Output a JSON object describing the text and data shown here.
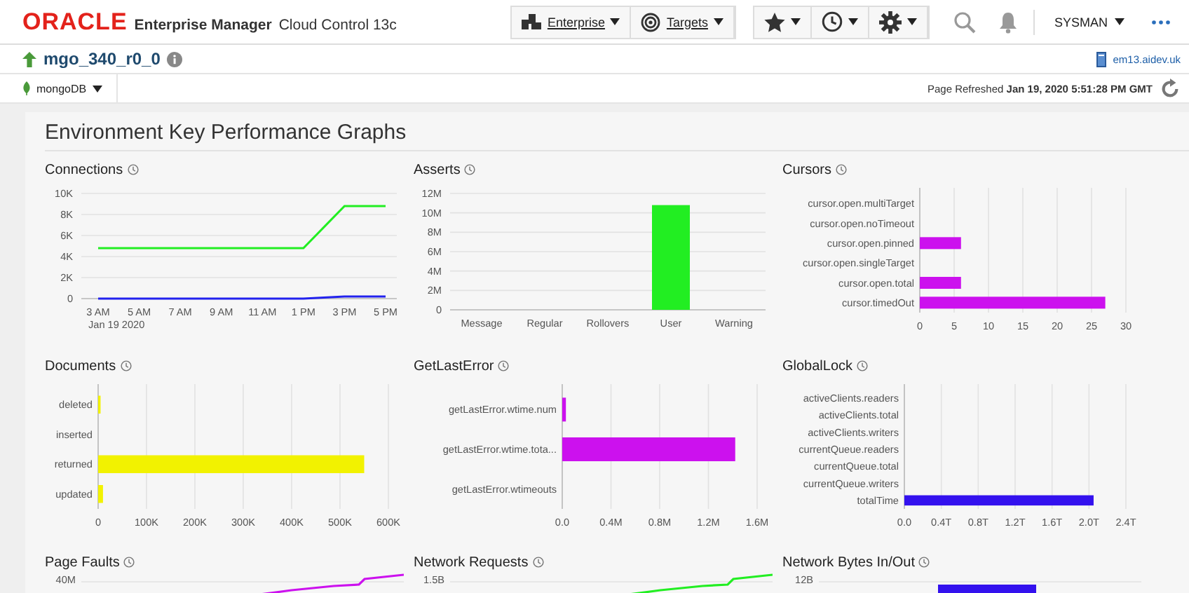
{
  "header": {
    "logo": "ORACLE",
    "product": "Enterprise Manager",
    "edition": "Cloud Control 13c",
    "menus": [
      {
        "label": "Enterprise"
      },
      {
        "label": "Targets"
      }
    ],
    "user": "SYSMAN"
  },
  "target": {
    "name": "mgo_340_r0_0",
    "host": "em13.aidev.uk",
    "type_menu": "mongoDB",
    "refreshed": "Page Refreshed **Jan 19, 2020 5:51:28 PM GMT**"
  },
  "region": {
    "title": "Environment Key Performance Graphs",
    "graphs": [
      {
        "title": "Connections",
        "chart_data": {
          "type": "line",
          "grid": true,
          "categories": [
            "3 AM",
            "5 AM",
            "7 AM",
            "9 AM",
            "11 AM",
            "1 PM",
            "3 PM",
            "5 PM"
          ],
          "xlabel": "Jan 19 2020",
          "ylim": [
            0,
            10000
          ],
          "yticks": [
            {
              "value": 0,
              "label": "0"
            },
            {
              "value": 2000,
              "label": "2K"
            },
            {
              "value": 4000,
              "label": "4K"
            },
            {
              "value": 6000,
              "label": "6K"
            },
            {
              "value": 8000,
              "label": "8K"
            },
            {
              "value": 10000,
              "label": "10K"
            }
          ],
          "series": [
            {
              "color": "#22ee22",
              "values": [
                4800,
                4800,
                4800,
                4800,
                4800,
                4800,
                8800,
                8800
              ]
            },
            {
              "color": "#2222ee",
              "values": [
                0,
                0,
                0,
                0,
                0,
                0,
                200,
                200
              ]
            }
          ]
        }
      },
      {
        "title": "Asserts",
        "chart_data": {
          "type": "bar",
          "grid": true,
          "orientation": "vertical",
          "categories": [
            "Message",
            "Regular",
            "Rollovers",
            "User",
            "Warning"
          ],
          "ylim": [
            0,
            12000000
          ],
          "yticks": [
            {
              "value": 0,
              "label": "0"
            },
            {
              "value": 2000000,
              "label": "2M"
            },
            {
              "value": 4000000,
              "label": "4M"
            },
            {
              "value": 6000000,
              "label": "6M"
            },
            {
              "value": 8000000,
              "label": "8M"
            },
            {
              "value": 10000000,
              "label": "10M"
            },
            {
              "value": 12000000,
              "label": "12M"
            }
          ],
          "series": [
            {
              "color": "#22ee22",
              "values": [
                0,
                0,
                0,
                10800000,
                0
              ]
            }
          ]
        }
      },
      {
        "title": "Cursors",
        "chart_data": {
          "type": "bar",
          "grid": true,
          "orientation": "horizontal",
          "categories": [
            "cursor.open.multiTarget",
            "cursor.open.noTimeout",
            "cursor.open.pinned",
            "cursor.open.singleTarget",
            "cursor.open.total",
            "cursor.timedOut"
          ],
          "xlim": [
            0,
            30
          ],
          "xticks": [
            0,
            5,
            10,
            15,
            20,
            25,
            30
          ],
          "series": [
            {
              "color": "#cc11ee",
              "values": [
                0,
                0,
                6,
                0,
                6,
                27
              ]
            }
          ]
        }
      },
      {
        "title": "Documents",
        "chart_data": {
          "type": "bar",
          "grid": true,
          "orientation": "horizontal",
          "categories": [
            "deleted",
            "inserted",
            "returned",
            "updated"
          ],
          "xlim": [
            0,
            600000
          ],
          "xticks": [
            {
              "value": 0,
              "label": "0"
            },
            {
              "value": 100000,
              "label": "100K"
            },
            {
              "value": 200000,
              "label": "200K"
            },
            {
              "value": 300000,
              "label": "300K"
            },
            {
              "value": 400000,
              "label": "400K"
            },
            {
              "value": 500000,
              "label": "500K"
            },
            {
              "value": 600000,
              "label": "600K"
            }
          ],
          "series": [
            {
              "color": "#f2f200",
              "values": [
                5000,
                0,
                550000,
                10000
              ]
            }
          ]
        }
      },
      {
        "title": "GetLastError",
        "chart_data": {
          "type": "bar",
          "grid": true,
          "orientation": "horizontal",
          "categories": [
            "getLastError.wtime.num",
            "getLastError.wtime.tota...",
            "getLastError.wtimeouts"
          ],
          "xlim": [
            0,
            1600000
          ],
          "xticks": [
            {
              "value": 0,
              "label": "0.0"
            },
            {
              "value": 400000,
              "label": "0.4M"
            },
            {
              "value": 800000,
              "label": "0.8M"
            },
            {
              "value": 1200000,
              "label": "1.2M"
            },
            {
              "value": 1600000,
              "label": "1.6M"
            }
          ],
          "series": [
            {
              "color": "#cc11ee",
              "values": [
                30000,
                1420000,
                0
              ]
            }
          ]
        }
      },
      {
        "title": "GlobalLock",
        "chart_data": {
          "type": "bar",
          "grid": true,
          "orientation": "horizontal",
          "categories": [
            "activeClients.readers",
            "activeClients.total",
            "activeClients.writers",
            "currentQueue.readers",
            "currentQueue.total",
            "currentQueue.writers",
            "totalTime"
          ],
          "xlim": [
            0,
            2.4
          ],
          "xticks": [
            {
              "value": 0,
              "label": "0.0"
            },
            {
              "value": 0.4,
              "label": "0.4T"
            },
            {
              "value": 0.8,
              "label": "0.8T"
            },
            {
              "value": 1.2,
              "label": "1.2T"
            },
            {
              "value": 1.6,
              "label": "1.6T"
            },
            {
              "value": 2.0,
              "label": "2.0T"
            },
            {
              "value": 2.4,
              "label": "2.4T"
            }
          ],
          "series": [
            {
              "color": "#3311ee",
              "values": [
                0,
                0,
                0,
                0,
                0,
                0,
                2.05
              ]
            }
          ]
        }
      },
      {
        "title": "Page Faults",
        "kind": "line",
        "color": "#cc11ee",
        "tick": "40M"
      },
      {
        "title": "Network Requests",
        "kind": "line",
        "color": "#22ee22",
        "tick": "1.5B"
      },
      {
        "title": "Network Bytes In/Out",
        "kind": "bar",
        "color": "#3311ee",
        "tick": "12B"
      }
    ]
  }
}
